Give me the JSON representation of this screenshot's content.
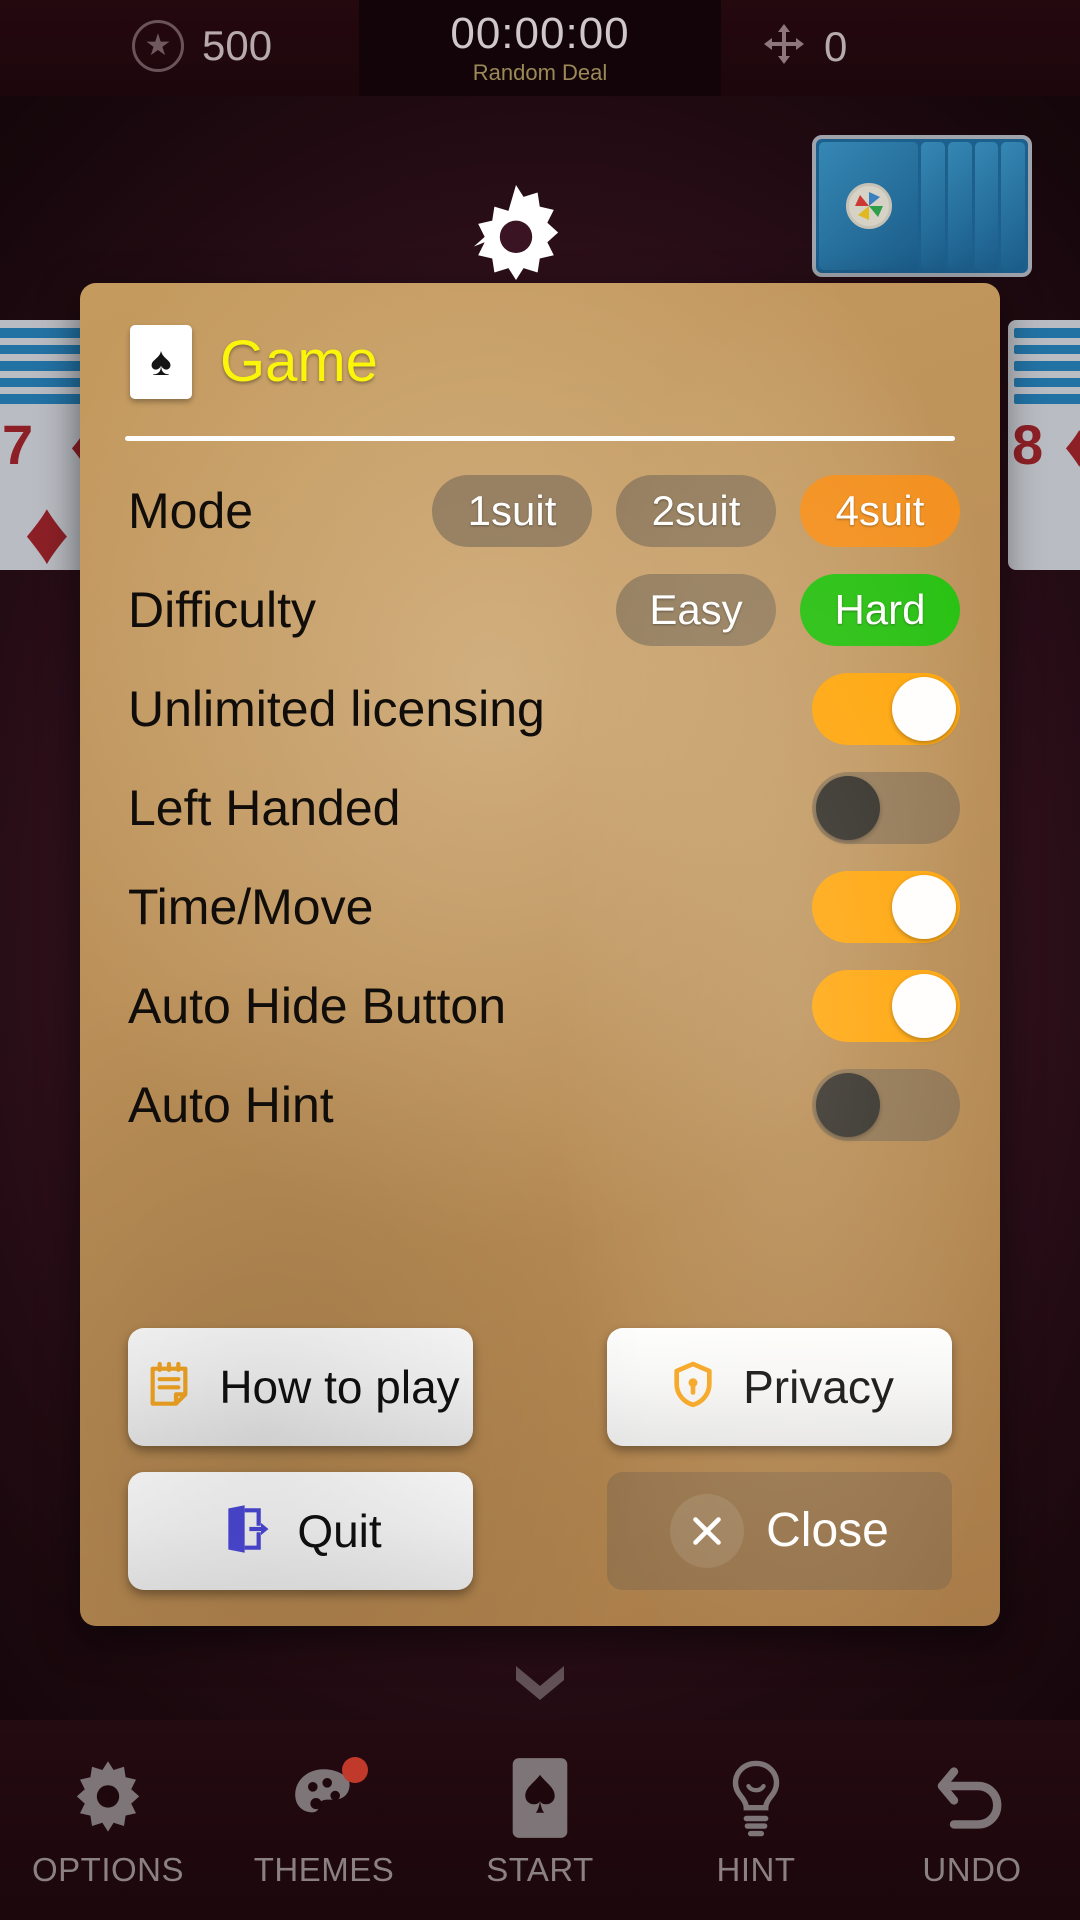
{
  "topbar": {
    "star_icon": "star-icon",
    "score": "500",
    "timer": "00:00:00",
    "deal_mode": "Random Deal",
    "moves_icon": "move-arrows-icon",
    "moves": "0"
  },
  "board": {
    "stock_icon": "pinwheel-emblem-icon",
    "left_card_rank": "7",
    "left_card_suit": "♦",
    "right_card_rank": "8",
    "right_card_suit": "♦"
  },
  "dialog": {
    "gear_icon": "gear-icon",
    "card_icon": "spade-card-icon",
    "title": "Game",
    "rows": [
      {
        "label": "Mode",
        "type": "pills",
        "options": [
          {
            "text": "1suit",
            "selected": false,
            "color": ""
          },
          {
            "text": "2suit",
            "selected": false,
            "color": ""
          },
          {
            "text": "4suit",
            "selected": true,
            "color": "#f3901f"
          }
        ]
      },
      {
        "label": "Difficulty",
        "type": "pills",
        "options": [
          {
            "text": "Easy",
            "selected": false,
            "color": ""
          },
          {
            "text": "Hard",
            "selected": true,
            "color": "#25c010"
          }
        ]
      },
      {
        "label": "Unlimited licensing",
        "type": "switch",
        "state": "on"
      },
      {
        "label": "Left Handed",
        "type": "switch",
        "state": "off"
      },
      {
        "label": "Time/Move",
        "type": "switch",
        "state": "on"
      },
      {
        "label": "Auto Hide Button",
        "type": "switch",
        "state": "on"
      },
      {
        "label": "Auto Hint",
        "type": "switch",
        "state": "off"
      }
    ],
    "buttons": {
      "how_to_play": {
        "label": "How to play",
        "icon": "notepad-icon"
      },
      "privacy": {
        "label": "Privacy",
        "icon": "shield-lock-icon"
      },
      "quit": {
        "label": "Quit",
        "icon": "exit-door-icon"
      },
      "close": {
        "label": "Close",
        "icon": "close-x-icon"
      }
    }
  },
  "scroll_hint_icon": "chevron-down-icon",
  "navbar": {
    "items": [
      {
        "label": "OPTIONS",
        "icon": "gear-icon",
        "badge": false
      },
      {
        "label": "THEMES",
        "icon": "palette-icon",
        "badge": true
      },
      {
        "label": "START",
        "icon": "card-spade-icon",
        "badge": false
      },
      {
        "label": "HINT",
        "icon": "lightbulb-icon",
        "badge": false
      },
      {
        "label": "UNDO",
        "icon": "undo-arrow-icon",
        "badge": false
      }
    ]
  },
  "colors": {
    "accent_orange": "#f3901f",
    "accent_green": "#25c010",
    "switch_on": "#ffa50a",
    "title_yellow": "#fbf50a",
    "felt": "#3a1422"
  }
}
